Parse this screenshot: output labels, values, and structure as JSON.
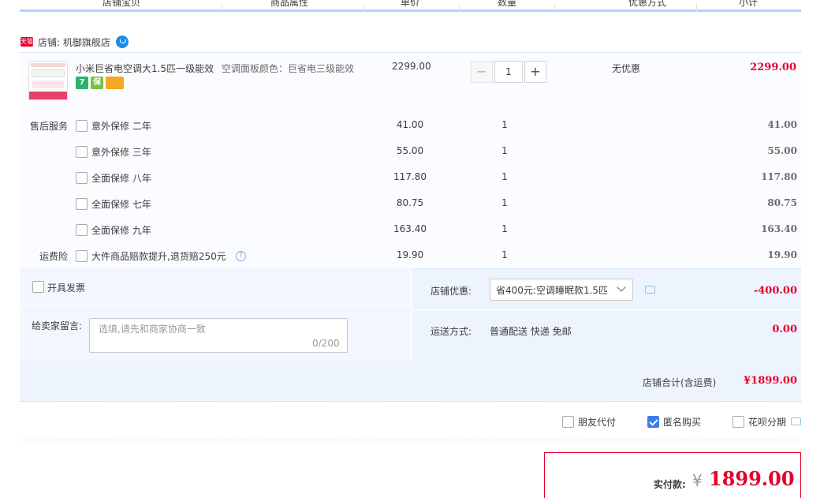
{
  "header": {
    "col_item": "店铺宝贝",
    "col_attr": "商品属性",
    "col_price": "单价",
    "col_qty": "数量",
    "col_discount": "优惠方式",
    "col_subtotal": "小计"
  },
  "shop": {
    "badge": "天猫",
    "name": "店铺: 机御旗舰店"
  },
  "product": {
    "title": "小米巨省电空调大1.5匹一级能效",
    "badges": [
      "7",
      "保",
      ""
    ],
    "attr": "空调面板颜色：巨省电三级能效",
    "price": "2299.00",
    "qty_minus": "−",
    "qty": "1",
    "qty_plus": "+",
    "discount": "无优惠",
    "subtotal": "2299.00"
  },
  "services": {
    "label": "售后服务",
    "items": [
      {
        "name": "意外保修 二年",
        "price": "41.00",
        "qty": "1",
        "subtotal": "41.00"
      },
      {
        "name": "意外保修 三年",
        "price": "55.00",
        "qty": "1",
        "subtotal": "55.00"
      },
      {
        "name": "全面保修 八年",
        "price": "117.80",
        "qty": "1",
        "subtotal": "117.80"
      },
      {
        "name": "全面保修 七年",
        "price": "80.75",
        "qty": "1",
        "subtotal": "80.75"
      },
      {
        "name": "全面保修 九年",
        "price": "163.40",
        "qty": "1",
        "subtotal": "163.40"
      }
    ]
  },
  "shipping_insurance": {
    "label": "运费险",
    "name": "大件商品赔款提升,退货赔250元",
    "help": "?",
    "price": "19.90",
    "qty": "1",
    "subtotal": "19.90"
  },
  "invoice": {
    "label": "开具发票"
  },
  "message": {
    "label": "给卖家留言:",
    "placeholder": "选填,请先和商家协商一致",
    "counter": "0/200"
  },
  "shop_discount": {
    "label": "店铺优惠:",
    "selected": "省400元:空调睡眠款1.5匹",
    "amount": "-400.00"
  },
  "delivery": {
    "label": "运送方式:",
    "value": "普通配送 快递 免邮",
    "amount": "0.00"
  },
  "shop_total": {
    "label": "店铺合计(含运费)",
    "amount": "¥1899.00"
  },
  "options": {
    "friend_pay": "朋友代付",
    "anonymous": "匿名购买",
    "huabei": "花呗分期"
  },
  "payment": {
    "label": "实付款:",
    "currency": "¥",
    "amount": "1899.00"
  },
  "colors": {
    "accent_red": "#e4002b",
    "header_line": "#b2d1ff",
    "panel_bg": "#eef4fe",
    "checkbox_blue": "#3b7de9"
  }
}
